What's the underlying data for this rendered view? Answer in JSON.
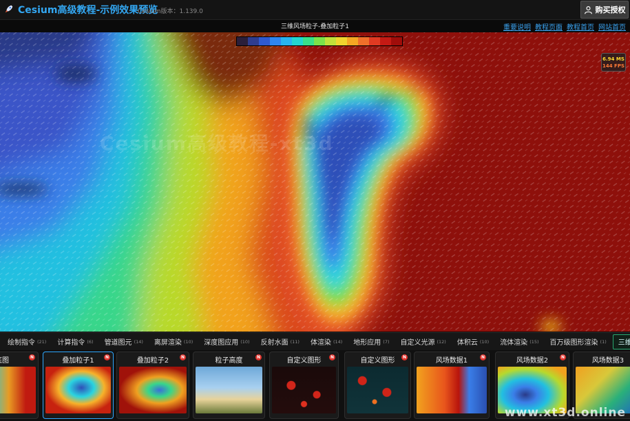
{
  "header": {
    "app_title": "Cesium高级教程-示例效果预览",
    "version": "Cesium版本：1.139.0",
    "buy_label": "购买授权"
  },
  "subbar": {
    "viewer_title": "三维风场粒子-叠加粒子1",
    "links": [
      "重要说明",
      "教程页面",
      "教程首页",
      "网站首页"
    ]
  },
  "viewer": {
    "watermark": "Cesium高级教程-xt3d",
    "fps_ms": "6.94 MS",
    "fps_fps": "144 FPS",
    "colorbar": [
      "#2a1f3a",
      "#2e3d8f",
      "#2f5ad0",
      "#2f86f0",
      "#28b3f0",
      "#22d6d0",
      "#38e08a",
      "#7be24a",
      "#c1e03a",
      "#f0d52e",
      "#f5a623",
      "#f0702a",
      "#e03a22",
      "#c41a14",
      "#a00d0a"
    ]
  },
  "tabs": [
    {
      "label": "绘制指令",
      "count": "(21)"
    },
    {
      "label": "计算指令",
      "count": "(6)"
    },
    {
      "label": "管道图元",
      "count": "(14)"
    },
    {
      "label": "离屏渲染",
      "count": "(10)"
    },
    {
      "label": "深度图应用",
      "count": "(10)"
    },
    {
      "label": "反射水面",
      "count": "(11)"
    },
    {
      "label": "体渲染",
      "count": "(14)"
    },
    {
      "label": "地形应用",
      "count": "(7)"
    },
    {
      "label": "自定义光源",
      "count": "(12)"
    },
    {
      "label": "体积云",
      "count": "(10)"
    },
    {
      "label": "流体渲染",
      "count": "(15)"
    },
    {
      "label": "百万级图形渲染",
      "count": "(1)"
    },
    {
      "label": "三维风场",
      "count": ""
    }
  ],
  "thumbnails": [
    {
      "title": "底图",
      "badge": "N"
    },
    {
      "title": "叠加粒子1",
      "badge": "N"
    },
    {
      "title": "叠加粒子2",
      "badge": "N"
    },
    {
      "title": "粒子高度",
      "badge": "N"
    },
    {
      "title": "自定义图形",
      "badge": "N"
    },
    {
      "title": "自定义图形",
      "badge": "N"
    },
    {
      "title": "风场数据1",
      "badge": "N"
    },
    {
      "title": "风场数据2",
      "badge": "N"
    },
    {
      "title": "风场数据3",
      "badge": ""
    }
  ],
  "site_watermark": "www.xt3d.online"
}
